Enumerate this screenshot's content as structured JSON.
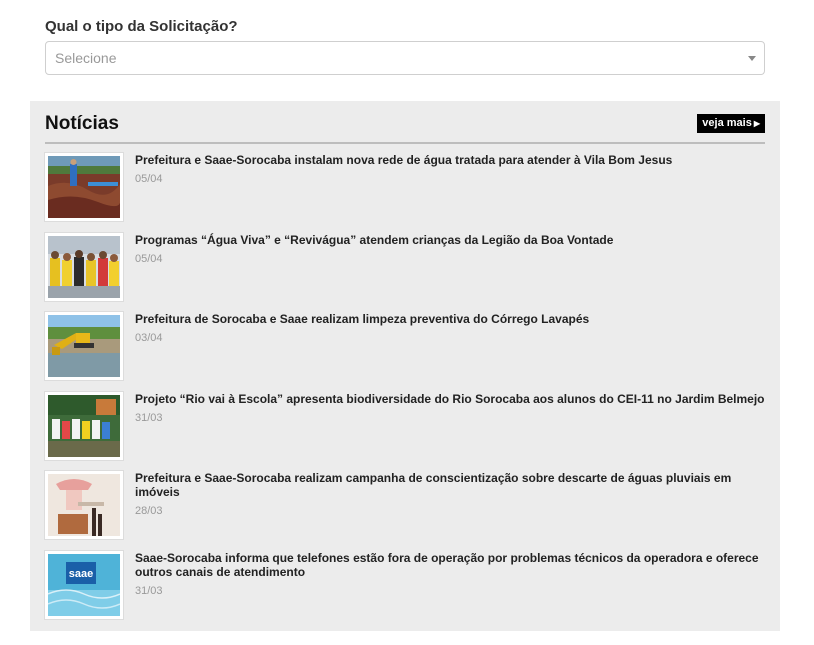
{
  "form": {
    "label": "Qual o tipo da Solicitação?",
    "select_value": "Selecione"
  },
  "news": {
    "title": "Notícias",
    "see_more": "veja mais",
    "items": [
      {
        "headline": "Prefeitura e Saae-Sorocaba instalam nova rede de água tratada para atender à Vila Bom Jesus",
        "date": "05/04"
      },
      {
        "headline": "Programas “Água Viva” e “Revivágua” atendem crianças da Legião da Boa Vontade",
        "date": "05/04"
      },
      {
        "headline": "Prefeitura de Sorocaba e Saae realizam limpeza preventiva do Córrego Lavapés",
        "date": "03/04"
      },
      {
        "headline": "Projeto “Rio vai à Escola” apresenta biodiversidade do Rio Sorocaba aos alunos do CEI-11 no Jardim Belmejo",
        "date": "31/03"
      },
      {
        "headline": "Prefeitura e Saae-Sorocaba realizam campanha de conscientização sobre descarte de águas pluviais em imóveis",
        "date": "28/03"
      },
      {
        "headline": "Saae-Sorocaba informa que telefones estão fora de operação por problemas técnicos da operadora e oferece outros canais de atendimento",
        "date": "31/03"
      }
    ],
    "logo_text": "saae"
  }
}
